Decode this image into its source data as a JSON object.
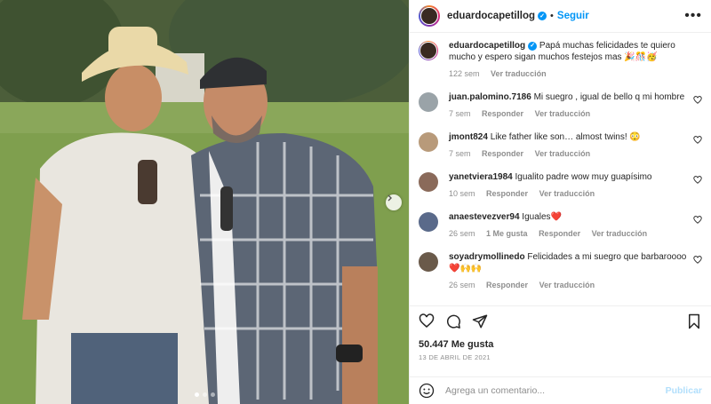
{
  "post": {
    "username": "eduardocapetillog",
    "follow_label": "Seguir",
    "more_label": "•••",
    "separator": "•",
    "caption": "Papá muchas felicidades te quiero mucho y espero sigan muchos festejos mas 🎉🎊🥳",
    "caption_age": "122 sem",
    "caption_translate": "Ver traducción"
  },
  "comments": [
    {
      "user": "juan.palomino.7186",
      "text": "Mi suegro , igual de bello q mi hombre",
      "age": "7 sem",
      "likes": "",
      "reply": "Responder",
      "translate": "Ver traducción",
      "avatar_color": "#9aa3a8"
    },
    {
      "user": "jmont824",
      "text": "Like father like son… almost twins! 😳",
      "age": "7 sem",
      "likes": "",
      "reply": "Responder",
      "translate": "Ver traducción",
      "avatar_color": "#b89a7a"
    },
    {
      "user": "yanetviera1984",
      "text": "Igualito padre wow muy guapísimo",
      "age": "10 sem",
      "likes": "",
      "reply": "Responder",
      "translate": "Ver traducción",
      "avatar_color": "#8a6a5a"
    },
    {
      "user": "anaestevezver94",
      "text": "Iguales❤️",
      "age": "26 sem",
      "likes": "1 Me gusta",
      "reply": "Responder",
      "translate": "Ver traducción",
      "avatar_color": "#5a6a8a"
    },
    {
      "user": "soyadrymollinedo",
      "text": "Felicidades a mi suegro que barbaroooo ❤️🙌🙌",
      "age": "26 sem",
      "likes": "",
      "reply": "Responder",
      "translate": "Ver traducción",
      "avatar_color": "#6a5a4a"
    }
  ],
  "footer": {
    "likes": "50.447 Me gusta",
    "date": "13 DE ABRIL DE 2021",
    "comment_placeholder": "Agrega un comentario...",
    "publish_label": "Publicar"
  }
}
